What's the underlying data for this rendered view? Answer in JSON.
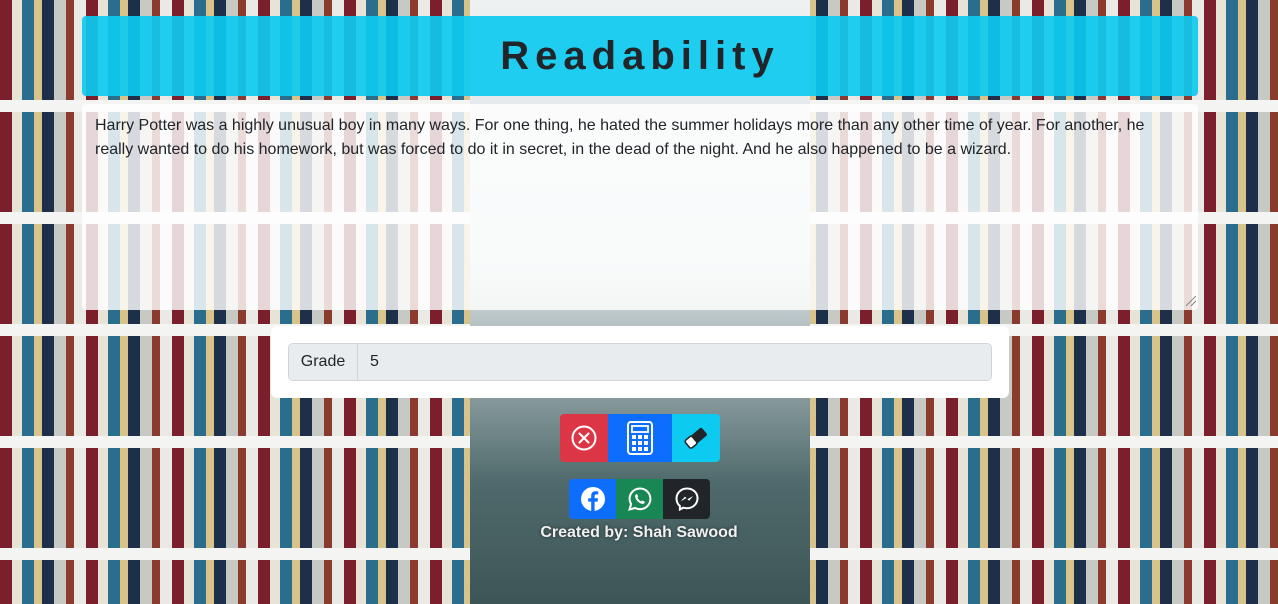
{
  "app": {
    "title": "Readability"
  },
  "editor": {
    "text": "Harry Potter was a highly unusual boy in many ways. For one thing, he hated the summer holidays more than any other time of year. For another, he really wanted to do his homework, but was forced to do it in secret, in the dead of the night. And he also happened to be a wizard."
  },
  "result": {
    "label": "Grade",
    "value": "5"
  },
  "actions": {
    "clear_icon": "circle-x-icon",
    "calculate_icon": "calculator-icon",
    "erase_icon": "eraser-icon",
    "colors": {
      "clear": "#dc3545",
      "calculate": "#0d6efd",
      "erase": "#0dcaf0"
    }
  },
  "share": {
    "facebook_icon": "facebook-icon",
    "whatsapp_icon": "whatsapp-icon",
    "messenger_icon": "messenger-icon",
    "colors": {
      "facebook": "#0d6efd",
      "whatsapp": "#198754",
      "messenger": "#212529"
    }
  },
  "footer": {
    "credit": "Created by: Shah Sawood"
  },
  "theme": {
    "accent": "#0dcaf0"
  }
}
